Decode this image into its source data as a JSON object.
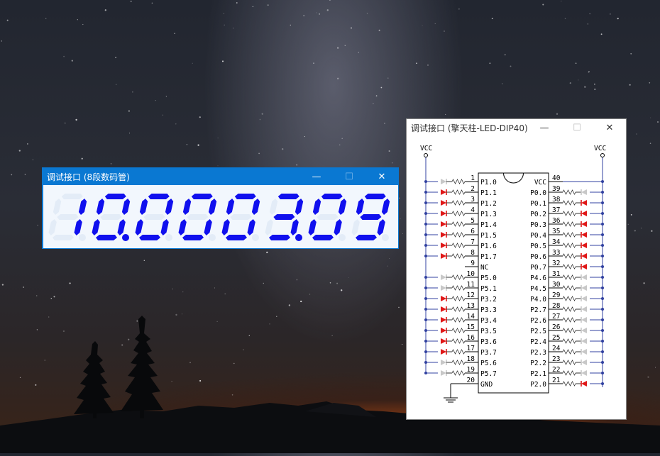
{
  "seven_seg_window": {
    "title": "调试接口 (8段数码管)",
    "controls": {
      "minimize": "—",
      "maximize": "☐",
      "close": "✕"
    },
    "digits": [
      "1",
      "0",
      "0",
      "0",
      "0",
      "3",
      "0",
      "9"
    ],
    "decimal_points": [
      false,
      true,
      false,
      false,
      false,
      true,
      false,
      false
    ],
    "color_on": "#1010ee",
    "color_off": "#e3ecf7"
  },
  "led_window": {
    "title": "调试接口 (擎天柱-LED-DIP40)",
    "controls": {
      "minimize": "—",
      "maximize": "☐",
      "close": "✕"
    },
    "vcc_label": "VCC",
    "led_on_color": "#e01818",
    "led_off_color": "#c8c8c8",
    "left_pins": [
      {
        "num": "1",
        "name": "P1.0",
        "led": "off"
      },
      {
        "num": "2",
        "name": "P1.1",
        "led": "on"
      },
      {
        "num": "3",
        "name": "P1.2",
        "led": "on"
      },
      {
        "num": "4",
        "name": "P1.3",
        "led": "on"
      },
      {
        "num": "5",
        "name": "P1.4",
        "led": "on"
      },
      {
        "num": "6",
        "name": "P1.5",
        "led": "on"
      },
      {
        "num": "7",
        "name": "P1.6",
        "led": "on"
      },
      {
        "num": "8",
        "name": "P1.7",
        "led": "on"
      },
      {
        "num": "9",
        "name": "NC",
        "led": "none"
      },
      {
        "num": "10",
        "name": "P5.0",
        "led": "off"
      },
      {
        "num": "11",
        "name": "P5.1",
        "led": "off"
      },
      {
        "num": "12",
        "name": "P3.2",
        "led": "on"
      },
      {
        "num": "13",
        "name": "P3.3",
        "led": "on"
      },
      {
        "num": "14",
        "name": "P3.4",
        "led": "on"
      },
      {
        "num": "15",
        "name": "P3.5",
        "led": "on"
      },
      {
        "num": "16",
        "name": "P3.6",
        "led": "on"
      },
      {
        "num": "17",
        "name": "P3.7",
        "led": "on"
      },
      {
        "num": "18",
        "name": "P5.6",
        "led": "off"
      },
      {
        "num": "19",
        "name": "P5.7",
        "led": "off"
      },
      {
        "num": "20",
        "name": "GND",
        "led": "none"
      }
    ],
    "right_pins": [
      {
        "num": "40",
        "name": "VCC",
        "led": "none"
      },
      {
        "num": "39",
        "name": "P0.0",
        "led": "off"
      },
      {
        "num": "38",
        "name": "P0.1",
        "led": "on"
      },
      {
        "num": "37",
        "name": "P0.2",
        "led": "on"
      },
      {
        "num": "36",
        "name": "P0.3",
        "led": "on"
      },
      {
        "num": "35",
        "name": "P0.4",
        "led": "on"
      },
      {
        "num": "34",
        "name": "P0.5",
        "led": "on"
      },
      {
        "num": "33",
        "name": "P0.6",
        "led": "on"
      },
      {
        "num": "32",
        "name": "P0.7",
        "led": "on"
      },
      {
        "num": "31",
        "name": "P4.6",
        "led": "off"
      },
      {
        "num": "30",
        "name": "P4.5",
        "led": "off"
      },
      {
        "num": "29",
        "name": "P4.0",
        "led": "off"
      },
      {
        "num": "28",
        "name": "P2.7",
        "led": "off"
      },
      {
        "num": "27",
        "name": "P2.6",
        "led": "off"
      },
      {
        "num": "26",
        "name": "P2.5",
        "led": "off"
      },
      {
        "num": "25",
        "name": "P2.4",
        "led": "off"
      },
      {
        "num": "24",
        "name": "P2.3",
        "led": "off"
      },
      {
        "num": "23",
        "name": "P2.2",
        "led": "off"
      },
      {
        "num": "22",
        "name": "P2.1",
        "led": "off"
      },
      {
        "num": "21",
        "name": "P2.0",
        "led": "on"
      }
    ]
  }
}
